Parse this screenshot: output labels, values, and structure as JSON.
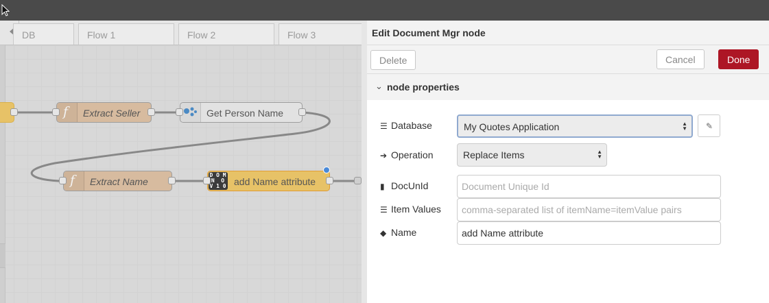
{
  "tabs": [
    "DB",
    "Flow 1",
    "Flow 2",
    "Flow 3"
  ],
  "nodes": {
    "extract_seller": "Extract Seller",
    "get_person_name": "Get Person Name",
    "extract_name": "Extract Name",
    "add_name_attribute": "add Name attribute",
    "domino_icon": "DOMINOV10"
  },
  "tray": {
    "title": "Edit Document Mgr node",
    "delete_label": "Delete",
    "cancel_label": "Cancel",
    "done_label": "Done",
    "section_title": "node properties",
    "fields": {
      "database": {
        "label": "Database",
        "value": "My Quotes Application"
      },
      "operation": {
        "label": "Operation",
        "value": "Replace Items"
      },
      "docunid": {
        "label": "DocUnId",
        "placeholder": "Document Unique Id"
      },
      "item_values": {
        "label": "Item Values",
        "placeholder": "comma-separated list of itemName=itemValue pairs"
      },
      "name": {
        "label": "Name",
        "value": "add Name attribute"
      }
    }
  },
  "colors": {
    "primary_button": "#ad1625",
    "function_node": "#d7bb9f",
    "domino_node": "#e7c267",
    "status_dot": "#4a8ad8"
  },
  "icons": [
    "cursor-icon",
    "chevron-left-icon",
    "function-icon",
    "person-icon",
    "domino-logo-icon",
    "database-icon",
    "arrow-circle-right-icon",
    "file-icon",
    "list-icon",
    "tag-icon",
    "pencil-icon",
    "chevron-down-icon"
  ]
}
